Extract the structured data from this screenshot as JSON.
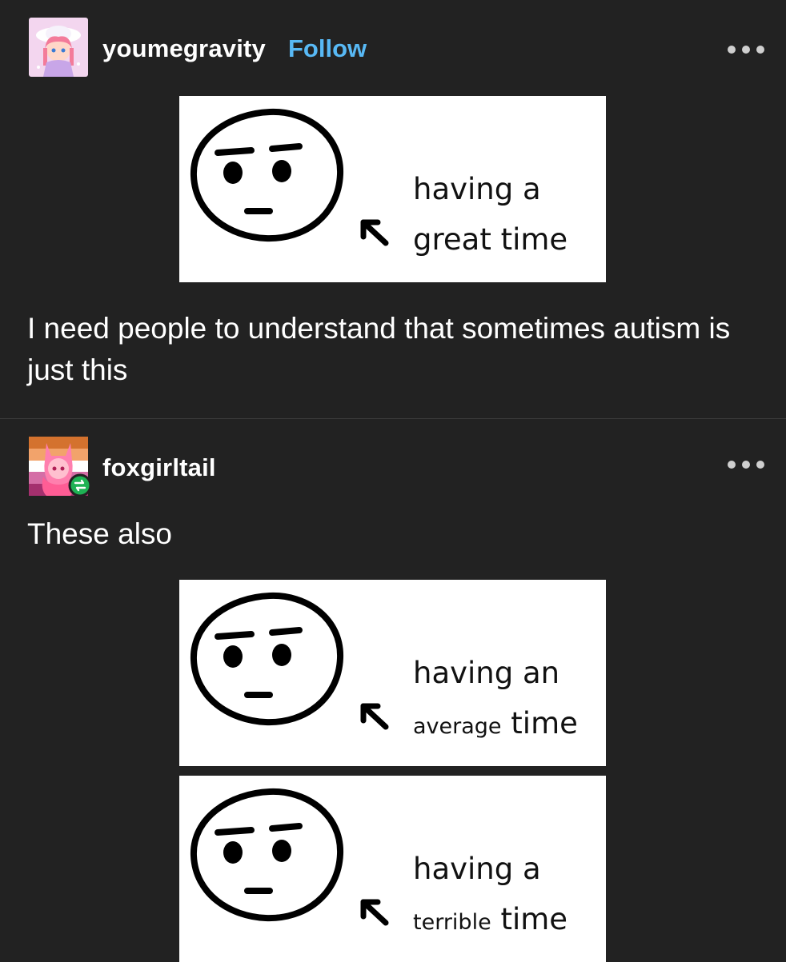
{
  "posts": [
    {
      "username": "youmegravity",
      "follow_label": "Follow",
      "image": {
        "caption_line1": "having a",
        "caption_line2": "great time"
      },
      "text": "I need people to understand that sometimes autism is just this"
    },
    {
      "username": "foxgirltail",
      "reblog_badge": "reblog-icon",
      "text": "These also",
      "images": [
        {
          "caption_line1": "having an",
          "caption_line2_small": "average",
          "caption_line2_big": "time"
        },
        {
          "caption_line1": "having a",
          "caption_line2_small": "terrible",
          "caption_line2_big": "time"
        }
      ]
    }
  ],
  "icons": {
    "more": "more-options-icon"
  },
  "colors": {
    "background": "#222222",
    "follow": "#58b9f5",
    "reblog_badge": "#1fb254"
  }
}
